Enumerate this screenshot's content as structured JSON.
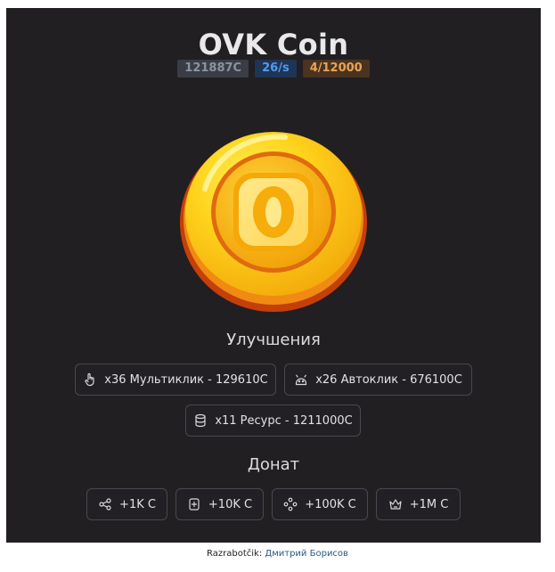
{
  "header": {
    "title": "OVK Coin",
    "coins": "121887C",
    "rate": "26/s",
    "limit": "4/12000"
  },
  "coin": {
    "letter": "O",
    "icon": "coin-icon"
  },
  "upgrades": {
    "title": "Улучшения",
    "items": [
      {
        "label": "x36 Мультиклик - 129610C",
        "icon": "tap-hand-icon"
      },
      {
        "label": "x26 Автоклик - 676100C",
        "icon": "robot-icon"
      },
      {
        "label": "x11 Ресурс - 1211000C",
        "icon": "database-icon"
      }
    ]
  },
  "donate": {
    "title": "Донат",
    "items": [
      {
        "label": "+1K C",
        "icon": "share-icon"
      },
      {
        "label": "+10K C",
        "icon": "plus-square-icon"
      },
      {
        "label": "+100K C",
        "icon": "nodes-icon"
      },
      {
        "label": "+1M C",
        "icon": "crown-icon"
      }
    ]
  },
  "footer": {
    "prefix": "Razrabotčik:",
    "author": "Дмитрий Борисов"
  },
  "colors": {
    "panel": "#211f22",
    "coin_gold": "#f7c61f",
    "coin_rim": "#c4400b",
    "badge_rate": "#4f9bf3",
    "badge_limit": "#e9a456",
    "link": "#2a5885"
  }
}
